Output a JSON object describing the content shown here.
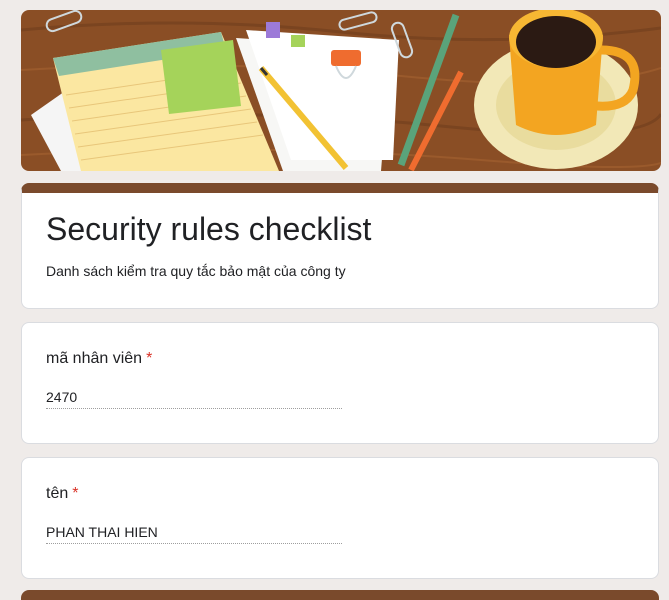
{
  "form": {
    "title": "Security rules checklist",
    "description": "Danh sách kiểm tra quy tắc bảo mật của công ty",
    "theme_color": "#7a4a2c"
  },
  "questions": [
    {
      "label": "mã nhân viên",
      "required_mark": "*",
      "answer": "2470"
    },
    {
      "label": "tên",
      "required_mark": "*",
      "answer": "PHAN THAI HIEN"
    }
  ],
  "colors": {
    "background": "#efebe9",
    "required": "#d93025",
    "text": "#202124"
  }
}
